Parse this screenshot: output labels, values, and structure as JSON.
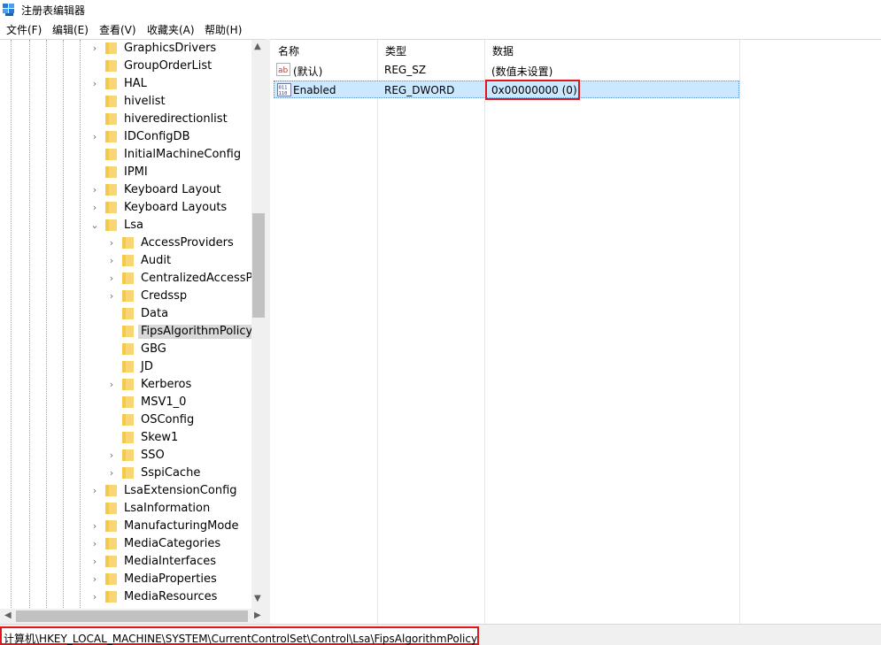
{
  "window": {
    "title": "注册表编辑器"
  },
  "menu": [
    "文件(F)",
    "编辑(E)",
    "查看(V)",
    "收藏夹(A)",
    "帮助(H)"
  ],
  "tree": {
    "items": [
      {
        "label": "GraphicsDrivers",
        "level": 1,
        "expandable": true,
        "selected": false
      },
      {
        "label": "GroupOrderList",
        "level": 1,
        "expandable": false,
        "selected": false
      },
      {
        "label": "HAL",
        "level": 1,
        "expandable": true,
        "selected": false
      },
      {
        "label": "hivelist",
        "level": 1,
        "expandable": false,
        "selected": false
      },
      {
        "label": "hiveredirectionlist",
        "level": 1,
        "expandable": false,
        "selected": false
      },
      {
        "label": "IDConfigDB",
        "level": 1,
        "expandable": true,
        "selected": false
      },
      {
        "label": "InitialMachineConfig",
        "level": 1,
        "expandable": false,
        "selected": false
      },
      {
        "label": "IPMI",
        "level": 1,
        "expandable": false,
        "selected": false
      },
      {
        "label": "Keyboard Layout",
        "level": 1,
        "expandable": true,
        "selected": false
      },
      {
        "label": "Keyboard Layouts",
        "level": 1,
        "expandable": true,
        "selected": false
      },
      {
        "label": "Lsa",
        "level": 1,
        "expandable": true,
        "expanded": true,
        "selected": false
      },
      {
        "label": "AccessProviders",
        "level": 2,
        "expandable": true,
        "selected": false
      },
      {
        "label": "Audit",
        "level": 2,
        "expandable": true,
        "selected": false
      },
      {
        "label": "CentralizedAccessPoli",
        "level": 2,
        "expandable": true,
        "selected": false
      },
      {
        "label": "Credssp",
        "level": 2,
        "expandable": true,
        "selected": false
      },
      {
        "label": "Data",
        "level": 2,
        "expandable": false,
        "selected": false
      },
      {
        "label": "FipsAlgorithmPolicy",
        "level": 2,
        "expandable": false,
        "selected": true
      },
      {
        "label": "GBG",
        "level": 2,
        "expandable": false,
        "selected": false
      },
      {
        "label": "JD",
        "level": 2,
        "expandable": false,
        "selected": false
      },
      {
        "label": "Kerberos",
        "level": 2,
        "expandable": true,
        "selected": false
      },
      {
        "label": "MSV1_0",
        "level": 2,
        "expandable": false,
        "selected": false
      },
      {
        "label": "OSConfig",
        "level": 2,
        "expandable": false,
        "selected": false
      },
      {
        "label": "Skew1",
        "level": 2,
        "expandable": false,
        "selected": false
      },
      {
        "label": "SSO",
        "level": 2,
        "expandable": true,
        "selected": false
      },
      {
        "label": "SspiCache",
        "level": 2,
        "expandable": true,
        "selected": false
      },
      {
        "label": "LsaExtensionConfig",
        "level": 1,
        "expandable": true,
        "selected": false
      },
      {
        "label": "LsaInformation",
        "level": 1,
        "expandable": false,
        "selected": false
      },
      {
        "label": "ManufacturingMode",
        "level": 1,
        "expandable": true,
        "selected": false
      },
      {
        "label": "MediaCategories",
        "level": 1,
        "expandable": true,
        "selected": false
      },
      {
        "label": "MediaInterfaces",
        "level": 1,
        "expandable": true,
        "selected": false
      },
      {
        "label": "MediaProperties",
        "level": 1,
        "expandable": true,
        "selected": false
      },
      {
        "label": "MediaResources",
        "level": 1,
        "expandable": true,
        "selected": false
      }
    ]
  },
  "list": {
    "columns": {
      "name": "名称",
      "type": "类型",
      "data": "数据"
    },
    "rows": [
      {
        "name": "(默认)",
        "type": "REG_SZ",
        "data": "(数值未设置)",
        "icon": "string-value-icon",
        "selected": false
      },
      {
        "name": "Enabled",
        "type": "REG_DWORD",
        "data": "0x00000000 (0)",
        "icon": "dword-value-icon",
        "selected": true
      }
    ]
  },
  "statusbar": {
    "path": "计算机\\HKEY_LOCAL_MACHINE\\SYSTEM\\CurrentControlSet\\Control\\Lsa\\FipsAlgorithmPolicy"
  },
  "colors": {
    "selection": "#cce8ff",
    "highlight": "#e0161b",
    "folder": "#f8d675"
  }
}
